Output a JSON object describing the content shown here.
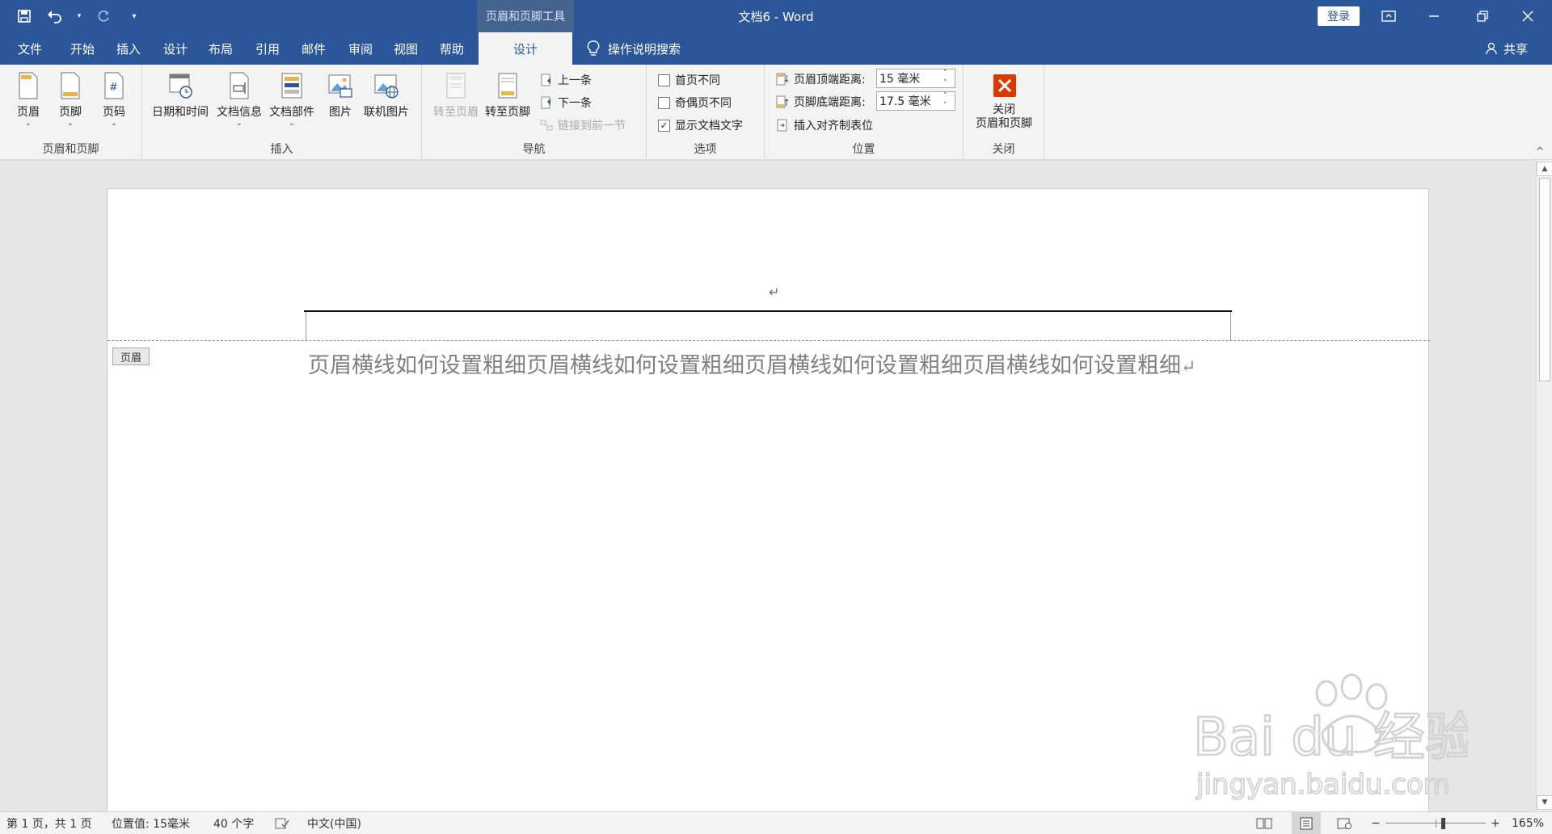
{
  "titlebar": {
    "context_tab": "页眉和页脚工具",
    "doc_title": "文档6 - Word",
    "login": "登录",
    "qat_icons": [
      "save-icon",
      "undo-icon",
      "redo-icon",
      "customize-icon"
    ],
    "bg_color": "#2b579a"
  },
  "tabs": [
    {
      "label": "文件"
    },
    {
      "label": "开始"
    },
    {
      "label": "插入"
    },
    {
      "label": "设计"
    },
    {
      "label": "布局"
    },
    {
      "label": "引用"
    },
    {
      "label": "邮件"
    },
    {
      "label": "审阅"
    },
    {
      "label": "视图"
    },
    {
      "label": "帮助"
    },
    {
      "label": "设计"
    }
  ],
  "tellme": "操作说明搜索",
  "share": "共享",
  "ribbon": {
    "groups": {
      "header_footer": {
        "label": "页眉和页脚",
        "header": "页眉",
        "footer": "页脚",
        "page_number": "页码"
      },
      "insert": {
        "label": "插入",
        "date_time": "日期和时间",
        "doc_info": "文档信息",
        "quick_parts": "文档部件",
        "pictures": "图片",
        "online_pictures": "联机图片"
      },
      "navigation": {
        "label": "导航",
        "goto_header": "转至页眉",
        "goto_footer": "转至页脚",
        "previous": "上一条",
        "next": "下一条",
        "link_previous": "链接到前一节"
      },
      "options": {
        "label": "选项",
        "different_first": "首页不同",
        "different_odd_even": "奇偶页不同",
        "show_doc_text": "显示文档文字",
        "show_doc_text_checked": true
      },
      "position": {
        "label": "位置",
        "header_top_label": "页眉顶端距离:",
        "header_top_value": "15 毫米",
        "footer_bottom_label": "页脚底端距离:",
        "footer_bottom_value": "17.5 毫米",
        "insert_align_tab": "插入对齐制表位"
      },
      "close": {
        "label": "关闭",
        "close_btn_line1": "关闭",
        "close_btn_line2": "页眉和页脚",
        "close_color": "#d83b01"
      }
    }
  },
  "document": {
    "header_tag": "页眉",
    "paragraph_mark": "↵",
    "body_text": "页眉横线如何设置粗细页眉横线如何设置粗细页眉横线如何设置粗细页眉横线如何设置粗细"
  },
  "statusbar": {
    "page": "第 1 页，共 1 页",
    "position": "位置值: 15毫米",
    "word_count": "40 个字",
    "language": "中文(中国)",
    "zoom_minus": "−",
    "zoom_plus": "+",
    "zoom": "165%"
  },
  "watermark": {
    "brand": "Bai du 经验",
    "url": "jingyan.baidu.com"
  }
}
